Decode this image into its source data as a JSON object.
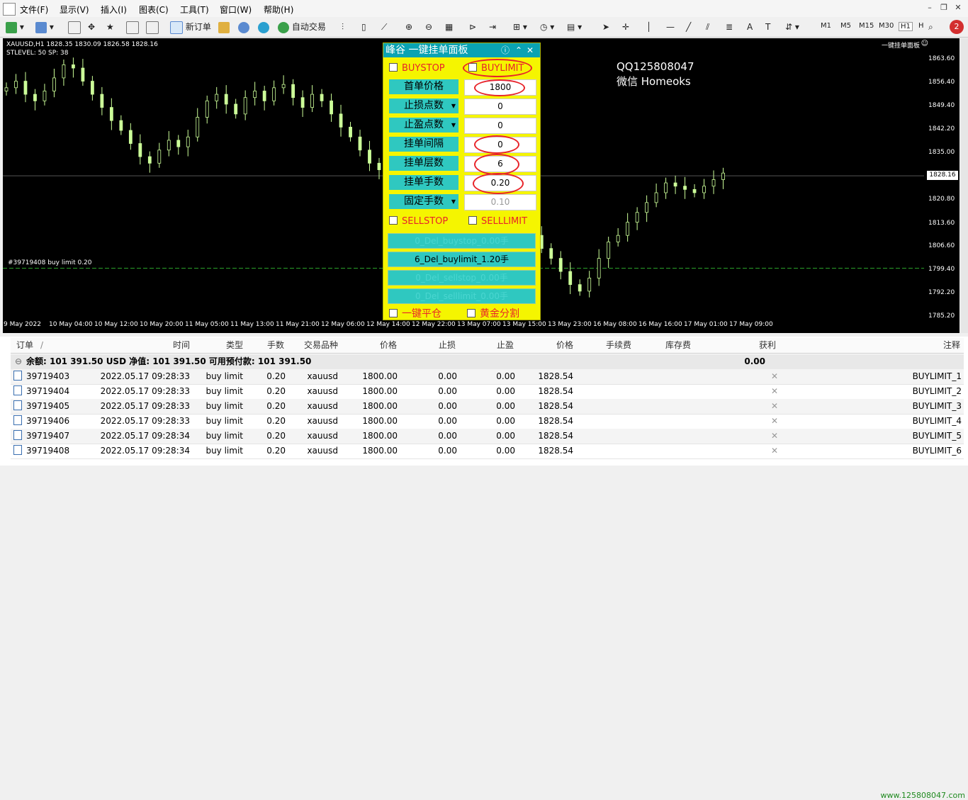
{
  "menu": [
    "文件(F)",
    "显示(V)",
    "插入(I)",
    "图表(C)",
    "工具(T)",
    "窗口(W)",
    "帮助(H)"
  ],
  "toolbar": {
    "new_order": "新订单",
    "auto_trade": "自动交易",
    "timeframes": [
      "M1",
      "M5",
      "M15",
      "M30",
      "H1",
      "H"
    ],
    "notify_count": "2"
  },
  "chart": {
    "symbol_line": "XAUUSD,H1  1828.35 1830.09 1826.58 1828.16",
    "stoplevel_line": "STLEVEL:  50     SP:  38",
    "ea_label": "一键挂单面板",
    "current_price": "1828.16",
    "order_label": "#39719408 buy limit 0.20",
    "watermark": [
      "QQ125808047",
      "微信 Homeoks"
    ],
    "y_ticks": [
      "1863.60",
      "1856.40",
      "1849.40",
      "1842.20",
      "1835.00",
      "1828.16",
      "1820.80",
      "1813.60",
      "1806.60",
      "1799.40",
      "1792.20",
      "1785.20"
    ],
    "x_ticks": [
      "9 May 2022",
      "10 May 04:00",
      "10 May 12:00",
      "10 May 20:00",
      "11 May 05:00",
      "11 May 13:00",
      "11 May 21:00",
      "12 May 06:00",
      "12 May 14:00",
      "12 May 22:00",
      "13 May 07:00",
      "13 May 15:00",
      "13 May 23:00",
      "16 May 08:00",
      "16 May 16:00",
      "17 May 01:00",
      "17 May 09:00"
    ]
  },
  "chart_data": {
    "type": "candlestick",
    "symbol": "XAUUSD",
    "timeframe": "H1",
    "ylim": [
      1785.2,
      1863.6
    ],
    "last": {
      "open": 1828.35,
      "high": 1830.09,
      "low": 1826.58,
      "close": 1828.16
    },
    "close_path": [
      1855,
      1857,
      1853,
      1851,
      1854,
      1858,
      1862,
      1861,
      1857,
      1853,
      1849,
      1845,
      1842,
      1838,
      1834,
      1832,
      1836,
      1839,
      1837,
      1840,
      1846,
      1851,
      1853,
      1850,
      1847,
      1852,
      1854,
      1851,
      1855,
      1856,
      1852,
      1849,
      1853,
      1851,
      1847,
      1843,
      1840,
      1836,
      1832,
      1830,
      1827,
      1823,
      1821,
      1825,
      1822,
      1819,
      1816,
      1812,
      1809,
      1807,
      1811,
      1813,
      1816,
      1818,
      1814,
      1810,
      1806,
      1803,
      1799,
      1795,
      1793,
      1797,
      1803,
      1808,
      1810,
      1814,
      1817,
      1820,
      1823,
      1826,
      1825,
      1824,
      1823,
      1825,
      1827,
      1829
    ],
    "pending_order_price": 1800.0
  },
  "panel": {
    "title": "峰谷 一键挂单面板",
    "buystop": "BUYSTOP",
    "buylimit": "BUYLIMIT",
    "sellstop": "SELLSTOP",
    "selllimit": "SELLLIMIT",
    "fields": [
      {
        "label": "首单价格",
        "value": "1800"
      },
      {
        "label": "止损点数",
        "value": "0"
      },
      {
        "label": "止盈点数",
        "value": "0"
      },
      {
        "label": "挂单间隔",
        "value": "0"
      },
      {
        "label": "挂单层数",
        "value": "6"
      },
      {
        "label": "挂单手数",
        "value": "0.20"
      },
      {
        "label": "固定手数",
        "value": "0.10"
      }
    ],
    "del_buttons": [
      "0_Del_buystop_0.00手",
      "6_Del_buylimit_1.20手",
      "0_Del_sellstop_0.00手",
      "0_Del_selllimit_0.00手"
    ],
    "one_click_close": "一键平仓",
    "gold_split": "黄金分割"
  },
  "table": {
    "headers": [
      "订单",
      "时间",
      "类型",
      "手数",
      "交易品种",
      "价格",
      "止损",
      "止盈",
      "价格",
      "手续费",
      "库存费",
      "获利",
      "注释"
    ],
    "balance_line": "余额: 101 391.50 USD  净值: 101 391.50  可用预付款: 101 391.50",
    "balance_profit": "0.00",
    "rows": [
      {
        "order": "39719403",
        "time": "2022.05.17 09:28:33",
        "type": "buy limit",
        "lots": "0.20",
        "symbol": "xauusd",
        "price": "1800.00",
        "sl": "0.00",
        "tp": "0.00",
        "cur": "1828.54",
        "comment": "BUYLIMIT_1"
      },
      {
        "order": "39719404",
        "time": "2022.05.17 09:28:33",
        "type": "buy limit",
        "lots": "0.20",
        "symbol": "xauusd",
        "price": "1800.00",
        "sl": "0.00",
        "tp": "0.00",
        "cur": "1828.54",
        "comment": "BUYLIMIT_2"
      },
      {
        "order": "39719405",
        "time": "2022.05.17 09:28:33",
        "type": "buy limit",
        "lots": "0.20",
        "symbol": "xauusd",
        "price": "1800.00",
        "sl": "0.00",
        "tp": "0.00",
        "cur": "1828.54",
        "comment": "BUYLIMIT_3"
      },
      {
        "order": "39719406",
        "time": "2022.05.17 09:28:33",
        "type": "buy limit",
        "lots": "0.20",
        "symbol": "xauusd",
        "price": "1800.00",
        "sl": "0.00",
        "tp": "0.00",
        "cur": "1828.54",
        "comment": "BUYLIMIT_4"
      },
      {
        "order": "39719407",
        "time": "2022.05.17 09:28:34",
        "type": "buy limit",
        "lots": "0.20",
        "symbol": "xauusd",
        "price": "1800.00",
        "sl": "0.00",
        "tp": "0.00",
        "cur": "1828.54",
        "comment": "BUYLIMIT_5"
      },
      {
        "order": "39719408",
        "time": "2022.05.17 09:28:34",
        "type": "buy limit",
        "lots": "0.20",
        "symbol": "xauusd",
        "price": "1800.00",
        "sl": "0.00",
        "tp": "0.00",
        "cur": "1828.54",
        "comment": "BUYLIMIT_6"
      }
    ]
  },
  "website": "www.125808047.com",
  "colors": {
    "candle": "#ccff99",
    "panel_bg": "#f5f500",
    "panel_label": "#2fc8c0",
    "accent_red": "#e8242a",
    "title_bar": "#0aa3b3"
  }
}
